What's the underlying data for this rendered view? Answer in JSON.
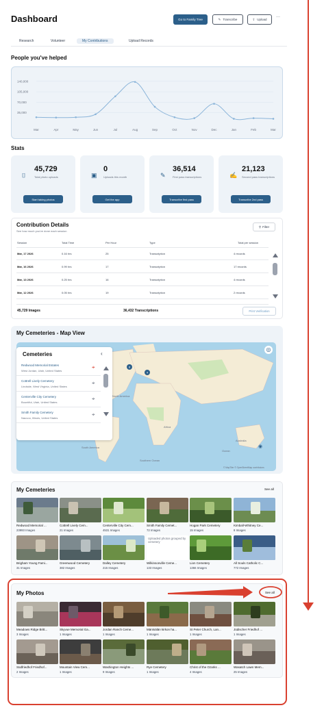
{
  "header": {
    "title": "Dashboard",
    "go_family_tree": "Go to Family Tree",
    "transcribe": "Transcribe",
    "upload": "Upload",
    "more": "···"
  },
  "tabs": [
    "Research",
    "Volunteer",
    "My Contributions",
    "Upload Records"
  ],
  "active_tab": "My Contributions",
  "helped": {
    "title": "People you've helped"
  },
  "chart_data": {
    "type": "line",
    "x": [
      "Mar",
      "Apr",
      "May",
      "Jun",
      "Jul",
      "Aug",
      "Sep",
      "Oct",
      "Nov",
      "Dec",
      "Jan",
      "Feb",
      "Mar"
    ],
    "values": [
      20000,
      19000,
      20000,
      30000,
      90000,
      138000,
      55000,
      20000,
      17000,
      65000,
      15000,
      17000,
      15000
    ],
    "yticks": [
      "140,000",
      "105,000",
      "70,000",
      "35,000"
    ],
    "ylim": [
      0,
      160000
    ],
    "color": "#8ab4d9"
  },
  "stats": {
    "title": "Stats",
    "items": [
      {
        "number": "45,729",
        "label": "Total photo uploads",
        "button": "Start taking photos",
        "icon": "camera-icon"
      },
      {
        "number": "0",
        "label": "Uploads this month",
        "button": "Get the app",
        "icon": "image-icon"
      },
      {
        "number": "36,514",
        "label": "First pass transcriptions",
        "button": "Transcribe first pass",
        "icon": "pencil-icon"
      },
      {
        "number": "21,123",
        "label": "Second pass transcriptions",
        "button": "Transcribe 2nd pass",
        "icon": "edit-icon"
      }
    ]
  },
  "contrib": {
    "title": "Contribution Details",
    "subtitle": "See how much you've done each session",
    "filter": "Filter",
    "headers": [
      "Session",
      "Total Time",
      "Per Hour",
      "Type",
      "Total per session"
    ],
    "rows": [
      {
        "session": "Mar, 17 2026",
        "time": "0.16 hrs",
        "per_hour": "25",
        "type": "Transcription",
        "total": "4 records"
      },
      {
        "session": "Mar, 16 2026",
        "time": "0.99 hrs",
        "per_hour": "17",
        "type": "Transcription",
        "total": "17 records"
      },
      {
        "session": "Mar, 13 2026",
        "time": "0.25 hrs",
        "per_hour": "16",
        "type": "Transcription",
        "total": "4 records"
      },
      {
        "session": "Mar, 12 2026",
        "time": "0.05 hrs",
        "per_hour": "19",
        "type": "Transcription",
        "total": "2 records"
      }
    ],
    "footer_images": "45,729 Images",
    "footer_transcriptions": "36,432 Transcriptions",
    "print": "Print Verification"
  },
  "map": {
    "title": "My Cemeteries - Map View",
    "panel_title": "Cemeteries",
    "items": [
      {
        "name": "Redwood Memorial Estates",
        "loc": "West Jordan, Utah, United States"
      },
      {
        "name": "Cottrell Lively Cemetery",
        "loc": "Lindside, West Virginia, United States"
      },
      {
        "name": "Centerville City Cemetery",
        "loc": "Bountiful, Utah, United States"
      },
      {
        "name": "Smith Family Cemetery",
        "loc": "Nauvoo, Illinois, United States"
      }
    ],
    "labels": {
      "na": "North America",
      "sa": "South America",
      "af": "Africa",
      "au": "Australia",
      "oc": "Southern Ocean",
      "ocean": "Ocean"
    },
    "attribution": "© MapTiler © OpenStreetMap contributors",
    "marker_a": "8",
    "marker_b": "4"
  },
  "cemeteries": {
    "title": "My Cemeteries",
    "see_all": "See all",
    "items": [
      {
        "name": "Redwood Memorial ...",
        "count": "23993 Images"
      },
      {
        "name": "Cottrell Lively Cem...",
        "count": "21 Images"
      },
      {
        "name": "Centerville City Cem...",
        "count": "4531 Images"
      },
      {
        "name": "Smith Family Cemet...",
        "count": "72 Images"
      },
      {
        "name": "Hogan Park Cemetery",
        "count": "15 Images"
      },
      {
        "name": "Kimball-Whitney Ce...",
        "count": "8 Images"
      },
      {
        "name": "Brigham Young Fami...",
        "count": "31 Images"
      },
      {
        "name": "Greenwood Cemetery",
        "count": "382 Images"
      },
      {
        "name": "Dalley Cemetery",
        "count": "215 Images"
      },
      {
        "name": "Wilkinsonville Ceme...",
        "count": "133 Images"
      },
      {
        "name": "Lion Cemetery",
        "count": "1366 Images"
      },
      {
        "name": "All Souls Catholic C...",
        "count": "772 Images"
      }
    ],
    "broken_alt": "Uploaded photos grouped by cemetery"
  },
  "photos": {
    "title": "My Photos",
    "see_all": "See all",
    "items": [
      {
        "name": "Meadows Ridge Britt...",
        "count": "3 Images"
      },
      {
        "name": "Skyvue Memorial Ga...",
        "count": "1 Images"
      },
      {
        "name": "Jordan Ranch Ceme...",
        "count": "1 Images"
      },
      {
        "name": "Mäntsälän kirkon ha...",
        "count": "1 Images"
      },
      {
        "name": "St Peter Church, Lan...",
        "count": "1 Images"
      },
      {
        "name": "Jüdischer Friedhof ...",
        "count": "1 Images"
      },
      {
        "name": "Südfriedhof Friedhof...",
        "count": "2 Images"
      },
      {
        "name": "Mountain View Cem...",
        "count": "1 Images"
      },
      {
        "name": "Washington Heights ...",
        "count": "9 Images"
      },
      {
        "name": "Rye Cemetery",
        "count": "1 Images"
      },
      {
        "name": "Christ of the Ozarks ...",
        "count": "4 Images"
      },
      {
        "name": "Wasatch Lawn Mem...",
        "count": "25 Images"
      }
    ]
  },
  "annotation_color": "#d9402f"
}
